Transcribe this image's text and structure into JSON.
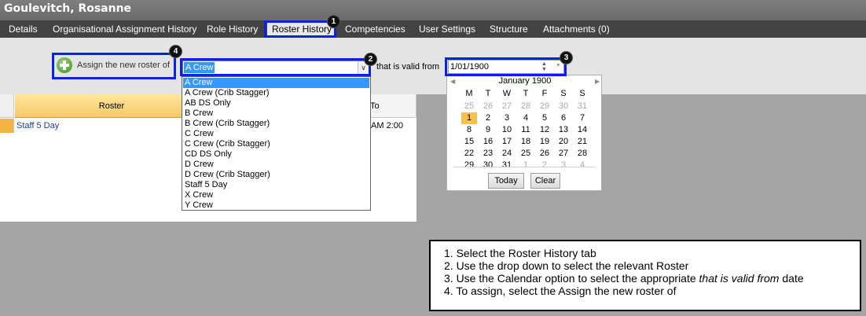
{
  "window": {
    "title": "Goulevitch, Rosanne"
  },
  "tabs": [
    {
      "label": "Details"
    },
    {
      "label": "Organisational Assignment History"
    },
    {
      "label": "Role History"
    },
    {
      "label": "Roster History"
    },
    {
      "label": "Competencies"
    },
    {
      "label": "User Settings"
    },
    {
      "label": "Structure"
    },
    {
      "label": "Attachments (0)"
    }
  ],
  "active_tab": "Roster History",
  "toolbar": {
    "assign_label": "Assign the new roster of",
    "roster_value": "A Crew",
    "valid_from_label": "that is valid from",
    "date_value": "1/01/1900"
  },
  "roster_options": [
    "A Crew",
    "A Crew (Crib Stagger)",
    "AB DS Only",
    "B Crew",
    "B Crew (Crib Stagger)",
    "C Crew",
    "C Crew (Crib Stagger)",
    "CD DS Only",
    "D Crew",
    "D Crew (Crib Stagger)",
    "Staff 5 Day",
    "X Crew",
    "Y Crew"
  ],
  "grid": {
    "headers": {
      "roster": "Roster",
      "to": "To"
    },
    "rows": [
      {
        "roster": "Staff 5 Day",
        "to": "2:00 AM"
      }
    ]
  },
  "calendar": {
    "month_label": "January 1900",
    "weekdays": [
      "M",
      "T",
      "W",
      "T",
      "F",
      "S",
      "S"
    ],
    "weeks": [
      [
        "25",
        "26",
        "27",
        "28",
        "29",
        "30",
        "31"
      ],
      [
        "1",
        "2",
        "3",
        "4",
        "5",
        "6",
        "7"
      ],
      [
        "8",
        "9",
        "10",
        "11",
        "12",
        "13",
        "14"
      ],
      [
        "15",
        "16",
        "17",
        "18",
        "19",
        "20",
        "21"
      ],
      [
        "22",
        "23",
        "24",
        "25",
        "26",
        "27",
        "28"
      ],
      [
        "29",
        "30",
        "31",
        "1",
        "2",
        "3",
        "4"
      ]
    ],
    "selected_day": "1",
    "today_button": "Today",
    "clear_button": "Clear"
  },
  "callouts": [
    "1",
    "2",
    "3",
    "4"
  ],
  "instructions": {
    "line1": "1. Select the Roster History tab",
    "line2": "2. Use the drop down to select the relevant Roster",
    "line3_pre": "3. Use the Calendar option to select the appropriate ",
    "line3_em": "that is valid from",
    "line3_post": " date",
    "line4": "4. To assign, select the Assign the new roster of"
  },
  "colors": {
    "callout_border": "#0a22e6",
    "selection": "#3399ff",
    "grid_header": "#f7c86a",
    "calendar_today": "#f7c049"
  }
}
